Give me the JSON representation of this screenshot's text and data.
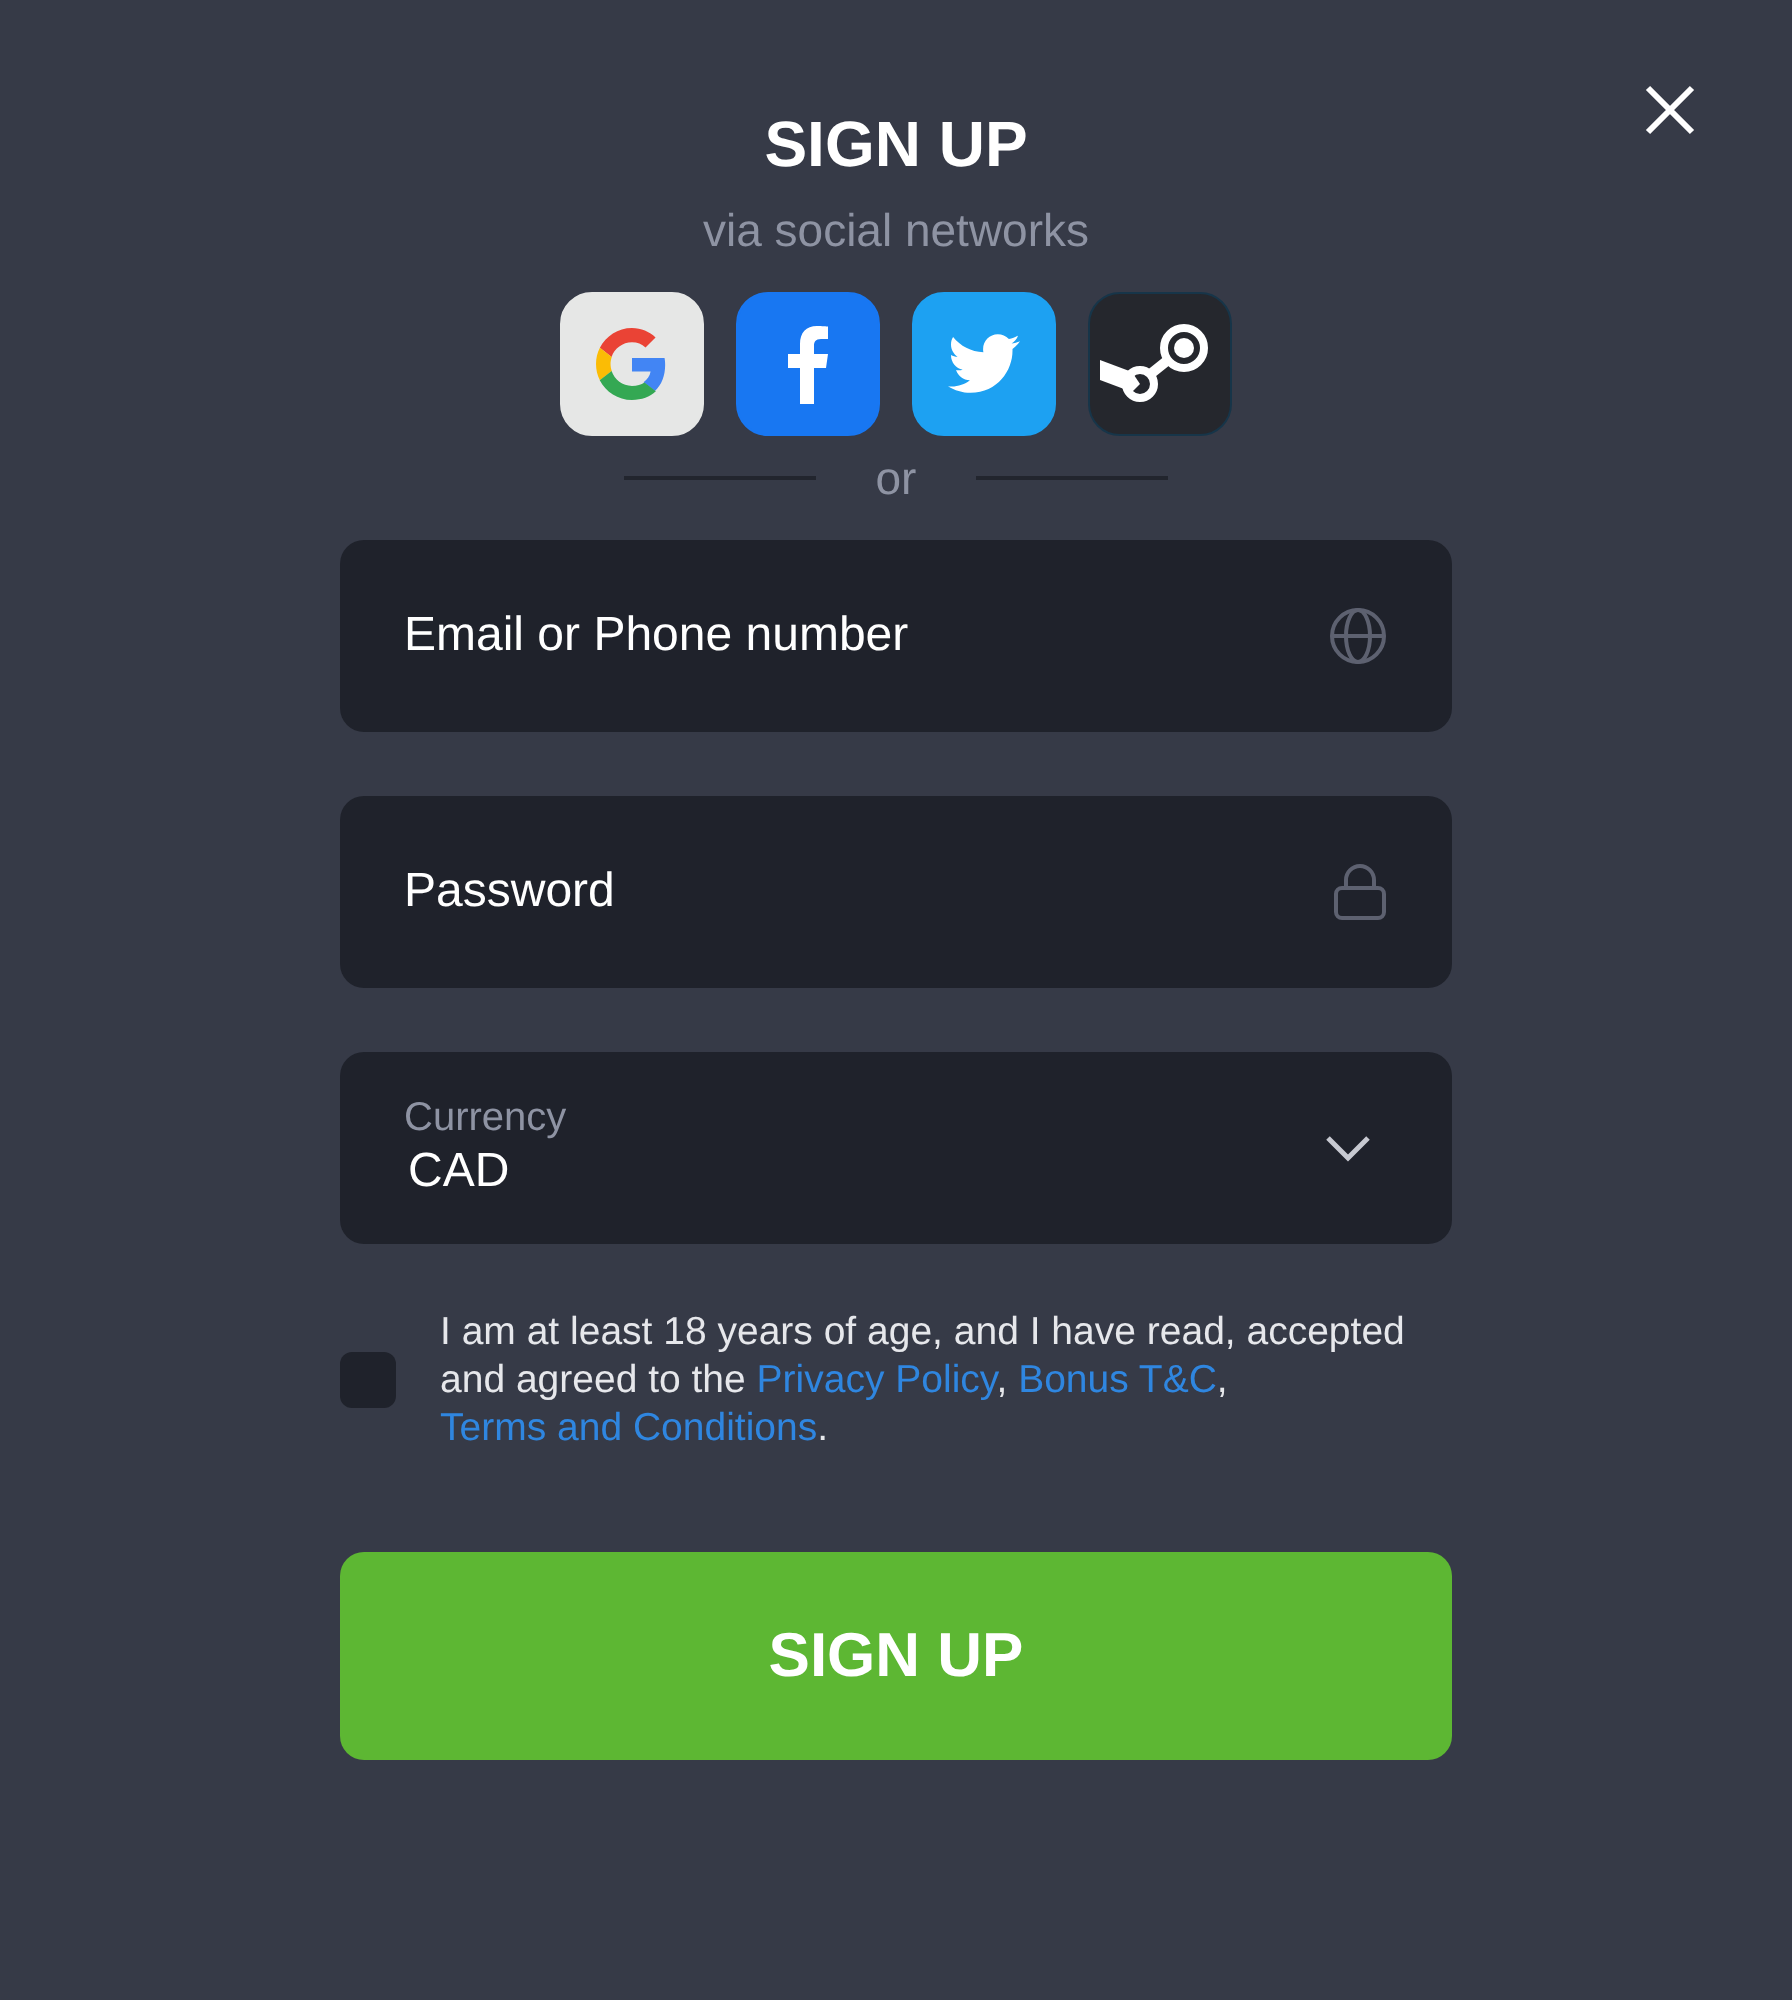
{
  "title": "SIGN UP",
  "subtitle": "via social networks",
  "social": [
    {
      "kind": "google"
    },
    {
      "kind": "facebook"
    },
    {
      "kind": "twitter"
    },
    {
      "kind": "steam"
    }
  ],
  "divider_text": "or",
  "fields": [
    {
      "kind": "email",
      "placeholder": "Email or Phone number"
    },
    {
      "kind": "password",
      "placeholder": "Password"
    }
  ],
  "currency": {
    "label": "Currency",
    "value": "CAD"
  },
  "agreement": {
    "checked": false,
    "parts": [
      {
        "kind": "text",
        "text": "I am at least 18 years of age, and I have read, accepted and agreed to the "
      },
      {
        "kind": "link",
        "text": "Privacy Policy"
      },
      {
        "kind": "text",
        "text": ", "
      },
      {
        "kind": "link",
        "text": "Bonus T&C"
      },
      {
        "kind": "text",
        "text": ", "
      },
      {
        "kind": "link",
        "text": "Terms and Conditions"
      },
      {
        "kind": "text",
        "text": "."
      }
    ]
  },
  "submit": "SIGN UP"
}
